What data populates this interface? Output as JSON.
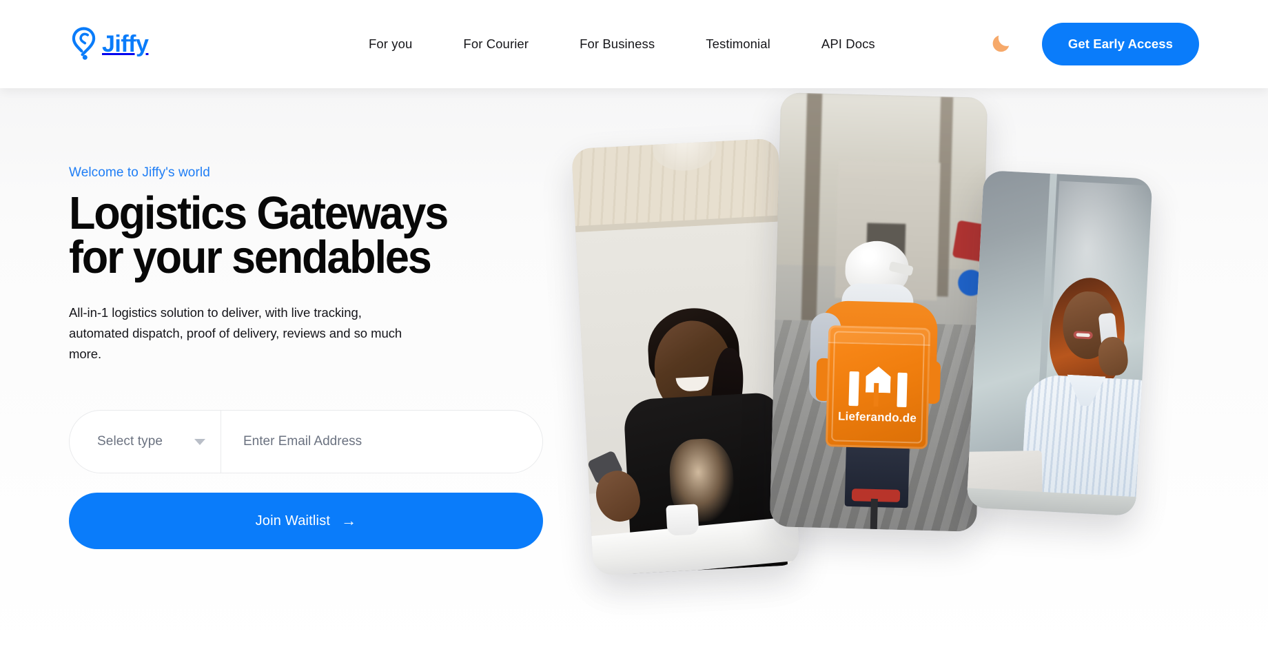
{
  "brand": {
    "name": "Jiffy",
    "logo_icon": "location-pin-icon",
    "accent_color": "#0a7cfa"
  },
  "header": {
    "nav_items": [
      {
        "label": "For you"
      },
      {
        "label": "For Courier"
      },
      {
        "label": "For Business"
      },
      {
        "label": "Testimonial"
      },
      {
        "label": "API Docs"
      }
    ],
    "theme_toggle": {
      "icon": "moon-icon",
      "color": "#f6a96a"
    },
    "cta": {
      "label": "Get Early Access",
      "color": "#0a7cfa"
    }
  },
  "hero": {
    "eyebrow": "Welcome to Jiffy's world",
    "eyebrow_color": "#1e7df5",
    "title": "Logistics Gateways\nfor your sendables",
    "subtitle": "All-in-1 logistics solution to deliver, with live tracking,\nautomated dispatch, proof of delivery, reviews and so much\nmore.",
    "form": {
      "select": {
        "value": "Select type",
        "caret_icon": "chevron-down-icon"
      },
      "email": {
        "value": "",
        "placeholder": "Enter Email Address"
      },
      "submit": {
        "label": "Join Waitlist",
        "arrow_icon": "arrow-right-icon",
        "arrow_glyph": "→"
      }
    },
    "images": [
      {
        "name": "man-laughing-with-phone",
        "alt": "Smiling man holding a phone at a white table indoors"
      },
      {
        "name": "courier-on-bicycle",
        "alt": "Courier riding a bicycle with an orange delivery backpack",
        "backpack_text": "Lieferando.de"
      },
      {
        "name": "woman-on-phone-call",
        "alt": "Smiling woman talking on a mobile phone by a window"
      }
    ]
  }
}
